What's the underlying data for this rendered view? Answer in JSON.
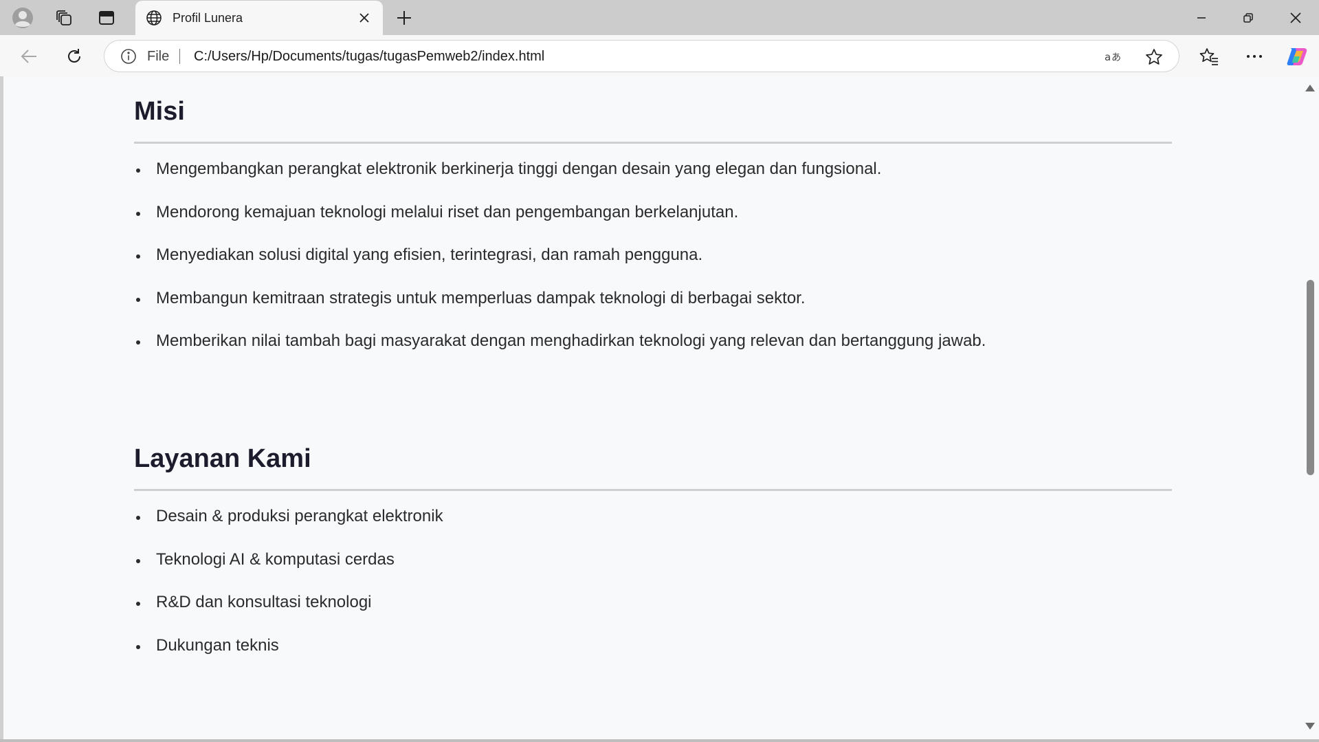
{
  "browser": {
    "tab_title": "Profil Lunera",
    "address_scheme_label": "File",
    "url": "C:/Users/Hp/Documents/tugas/tugasPemweb2/index.html"
  },
  "page": {
    "misi": {
      "heading": "Misi",
      "items": [
        "Mengembangkan perangkat elektronik berkinerja tinggi dengan desain yang elegan dan fungsional.",
        "Mendorong kemajuan teknologi melalui riset dan pengembangan berkelanjutan.",
        "Menyediakan solusi digital yang efisien, terintegrasi, dan ramah pengguna.",
        "Membangun kemitraan strategis untuk memperluas dampak teknologi di berbagai sektor.",
        "Memberikan nilai tambah bagi masyarakat dengan menghadirkan teknologi yang relevan dan bertanggung jawab."
      ]
    },
    "layanan": {
      "heading": "Layanan Kami",
      "items": [
        "Desain & produksi perangkat elektronik",
        "Teknologi AI & komputasi cerdas",
        "R&D dan konsultasi teknologi",
        "Dukungan teknis"
      ]
    }
  },
  "icons": {
    "profile": "profile-icon",
    "workspaces": "workspaces-icon",
    "tab_actions": "vertical-tabs-icon",
    "tab_favicon": "globe-icon",
    "close_tab": "close-icon",
    "new_tab": "plus-icon",
    "back": "back-arrow-icon",
    "refresh": "refresh-icon",
    "site_info": "info-icon",
    "read_aloud": "read-aloud-icon",
    "favorite": "star-icon",
    "favorites": "favorites-icon",
    "more": "more-icon",
    "copilot": "copilot-icon"
  },
  "colors": {
    "page_background": "#f8f9fb",
    "heading_text": "#1c1c2c",
    "body_text": "#2b2b2b",
    "rule": "#cfcfcf"
  }
}
